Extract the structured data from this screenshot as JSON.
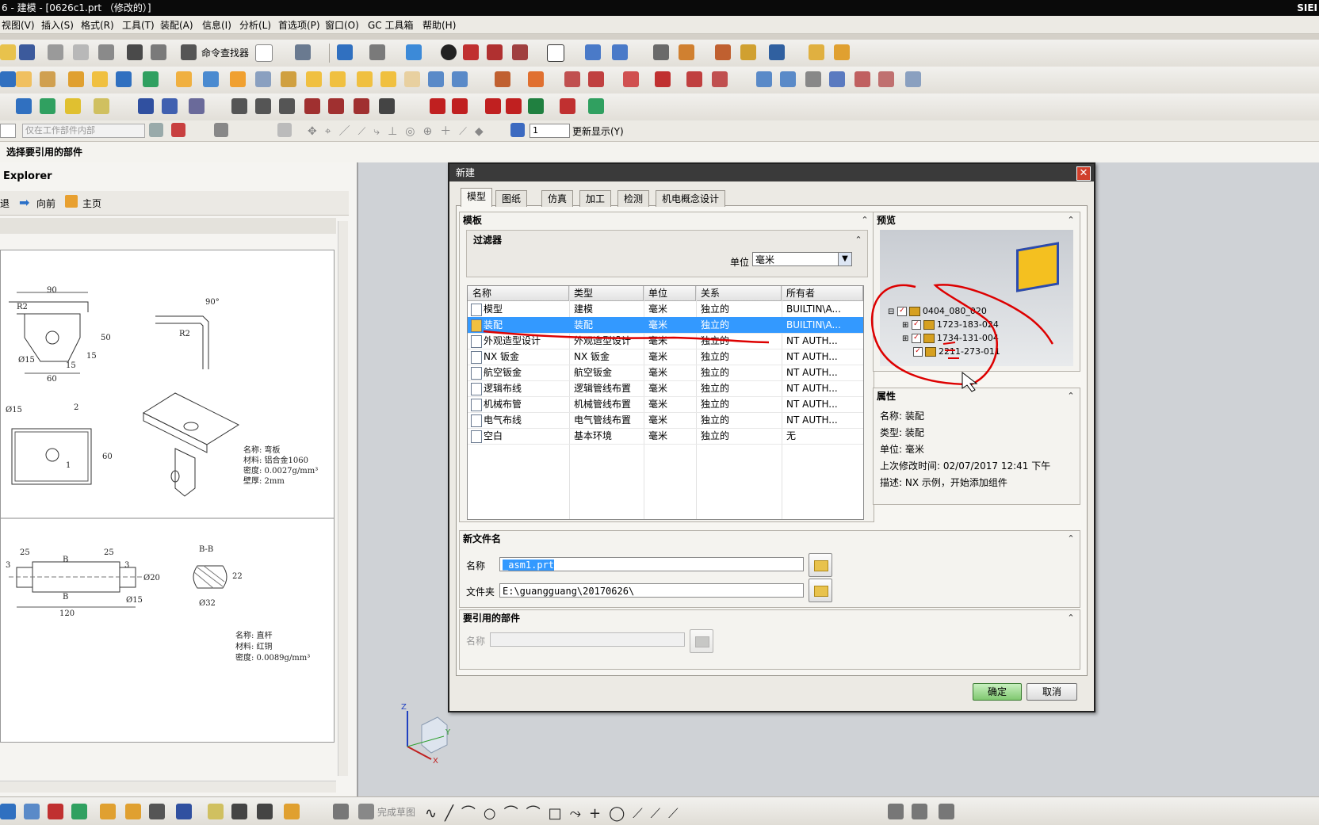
{
  "window": {
    "title": "6 - 建模 - [0626c1.prt （修改的）]",
    "brand": "SIEI"
  },
  "menu": [
    "视图(V)",
    "插入(S)",
    "格式(R)",
    "工具(T)",
    "装配(A)",
    "信息(I)",
    "分析(L)",
    "首选项(P)",
    "窗口(O)",
    "GC 工具箱",
    "帮助(H)"
  ],
  "toolbar": {
    "command_finder": "命令查找器",
    "update_display": "更新显示(Y)",
    "filter_placeholder": "仅在工作部件内部",
    "layer_value": "1"
  },
  "cue_line": "选择要引用的部件",
  "explorer": {
    "title": "Explorer",
    "back": "退",
    "forward": "向前",
    "home": "主页"
  },
  "drawing": {
    "dims": [
      "90",
      "R2",
      "90°",
      "R2",
      "50",
      "15",
      "15",
      "Ø15",
      "60",
      "Ø15",
      "2",
      "60",
      "1",
      "25",
      "25",
      "3",
      "3",
      "B",
      "B",
      "120",
      "Ø20",
      "Ø15",
      "B-B",
      "22",
      "Ø32"
    ],
    "note1": [
      "名称: 弯板",
      "材料: 铝合金1060",
      "密度: 0.0027g/mm³",
      "壁厚: 2mm"
    ],
    "note2": [
      "名称: 直杆",
      "材料: 红铜",
      "密度: 0.0089g/mm³"
    ]
  },
  "dialog": {
    "title": "新建",
    "close": "✕",
    "tabs": [
      "模型",
      "图纸",
      "仿真",
      "加工",
      "检测",
      "机电概念设计"
    ],
    "template_section": "模板",
    "filter_section": "过滤器",
    "unit_label": "单位",
    "unit_value": "毫米",
    "columns": [
      "名称",
      "类型",
      "单位",
      "关系",
      "所有者"
    ],
    "rows": [
      {
        "name": "模型",
        "type": "建模",
        "unit": "毫米",
        "rel": "独立的",
        "owner": "BUILTIN\\A..."
      },
      {
        "name": "装配",
        "type": "装配",
        "unit": "毫米",
        "rel": "独立的",
        "owner": "BUILTIN\\A..."
      },
      {
        "name": "外观造型设计",
        "type": "外观造型设计",
        "unit": "毫米",
        "rel": "独立的",
        "owner": "NT AUTH..."
      },
      {
        "name": "NX 钣金",
        "type": "NX 钣金",
        "unit": "毫米",
        "rel": "独立的",
        "owner": "NT AUTH..."
      },
      {
        "name": "航空钣金",
        "type": "航空钣金",
        "unit": "毫米",
        "rel": "独立的",
        "owner": "NT AUTH..."
      },
      {
        "name": "逻辑布线",
        "type": "逻辑管线布置",
        "unit": "毫米",
        "rel": "独立的",
        "owner": "NT AUTH..."
      },
      {
        "name": "机械布管",
        "type": "机械管线布置",
        "unit": "毫米",
        "rel": "独立的",
        "owner": "NT AUTH..."
      },
      {
        "name": "电气布线",
        "type": "电气管线布置",
        "unit": "毫米",
        "rel": "独立的",
        "owner": "NT AUTH..."
      },
      {
        "name": "空白",
        "type": "基本环境",
        "unit": "毫米",
        "rel": "独立的",
        "owner": "无"
      }
    ],
    "preview_section": "预览",
    "preview_tree": [
      "0404_080_020",
      "1723-183-024",
      "1734-131-004",
      "2211-273-011"
    ],
    "props_section": "属性",
    "props": [
      {
        "label": "名称:",
        "value": "装配"
      },
      {
        "label": "类型:",
        "value": "装配"
      },
      {
        "label": "单位:",
        "value": "毫米"
      },
      {
        "label": "上次修改时间:",
        "value": "02/07/2017 12:41 下午"
      },
      {
        "label": "描述:",
        "value": "NX 示例，开始添加组件"
      }
    ],
    "newfile_section": "新文件名",
    "name_label": "名称",
    "name_value": "_asm1.prt",
    "folder_label": "文件夹",
    "folder_value": "E:\\guangguang\\20170626\\",
    "refpart_section": "要引用的部件",
    "ref_name_label": "名称",
    "ok": "确定",
    "cancel": "取消"
  },
  "statusbar": {
    "finish_sketch": "完成草图"
  },
  "colors": {
    "selection": "#3399ff",
    "annotation": "#dd0000",
    "titlebar": "#0a0a0a"
  }
}
